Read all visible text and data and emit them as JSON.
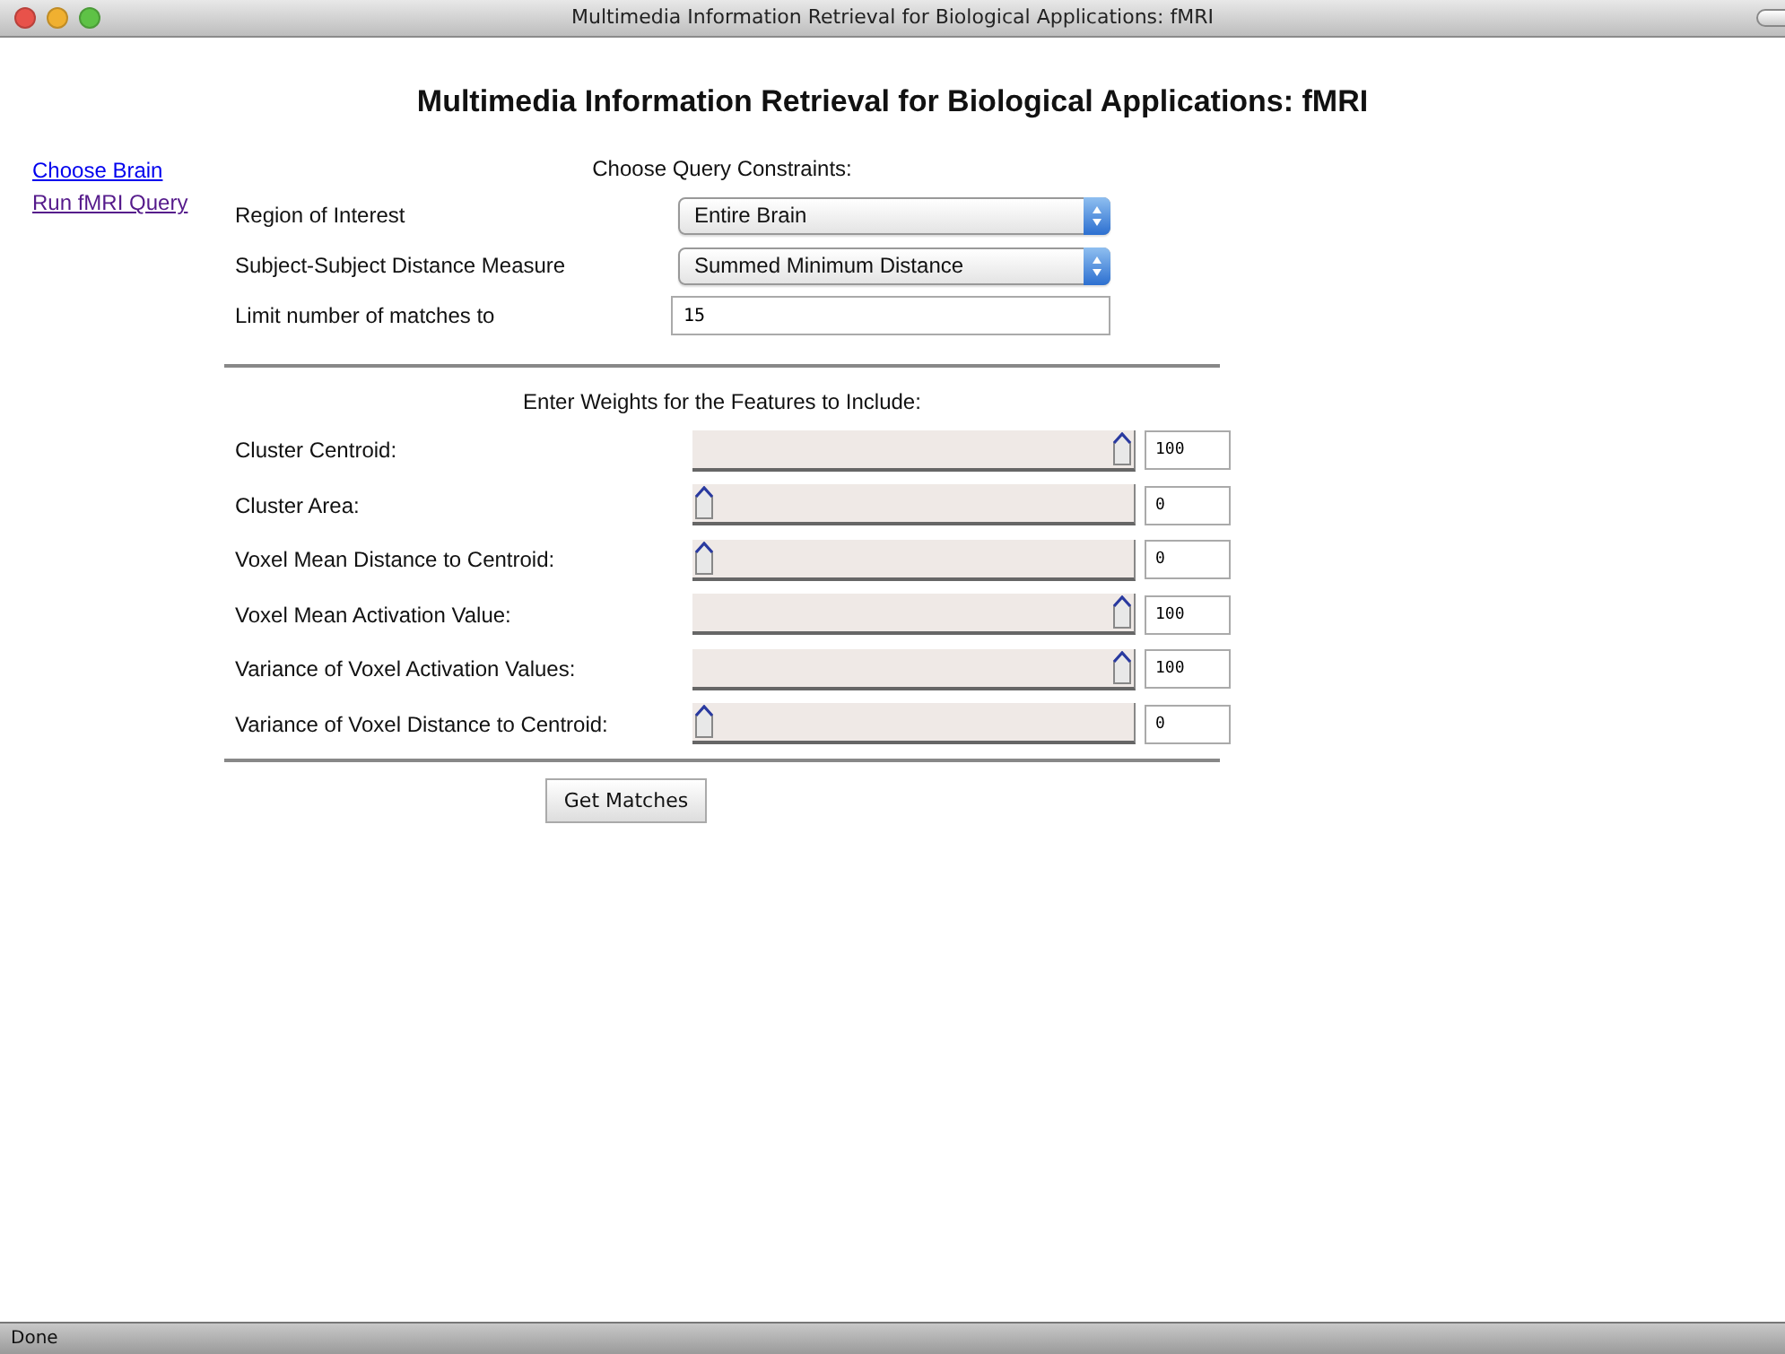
{
  "window": {
    "title": "Multimedia Information Retrieval for Biological Applications: fMRI"
  },
  "heading": "Multimedia Information Retrieval for Biological Applications: fMRI",
  "nav_links": [
    {
      "label": "Choose Brain",
      "visited": false
    },
    {
      "label": "Run fMRI Query",
      "visited": true
    }
  ],
  "constraints": {
    "title": "Choose Query Constraints:",
    "fields": [
      {
        "kind": "select",
        "label": "Region of Interest",
        "value": "Entire Brain"
      },
      {
        "kind": "select",
        "label": "Subject-Subject Distance Measure",
        "value": "Summed Minimum Distance"
      },
      {
        "kind": "text",
        "label": "Limit number of matches to",
        "value": "15"
      }
    ]
  },
  "weights": {
    "title": "Enter Weights for the Features to Include:",
    "rows": [
      {
        "label": "Cluster Centroid:",
        "level": 1,
        "value": "100"
      },
      {
        "label": "Cluster Area:",
        "level": 0,
        "value": "0"
      },
      {
        "label": "Voxel Mean Distance to Centroid:",
        "level": 0,
        "value": "0"
      },
      {
        "label": "Voxel Mean Activation Value:",
        "level": 1,
        "value": "100"
      },
      {
        "label": "Variance of Voxel Activation Values:",
        "level": 1,
        "value": "100"
      },
      {
        "label": "Variance of Voxel Distance to Centroid:",
        "level": 0,
        "value": "0"
      }
    ]
  },
  "submit_button": "Get Matches",
  "status_bar": "Done"
}
